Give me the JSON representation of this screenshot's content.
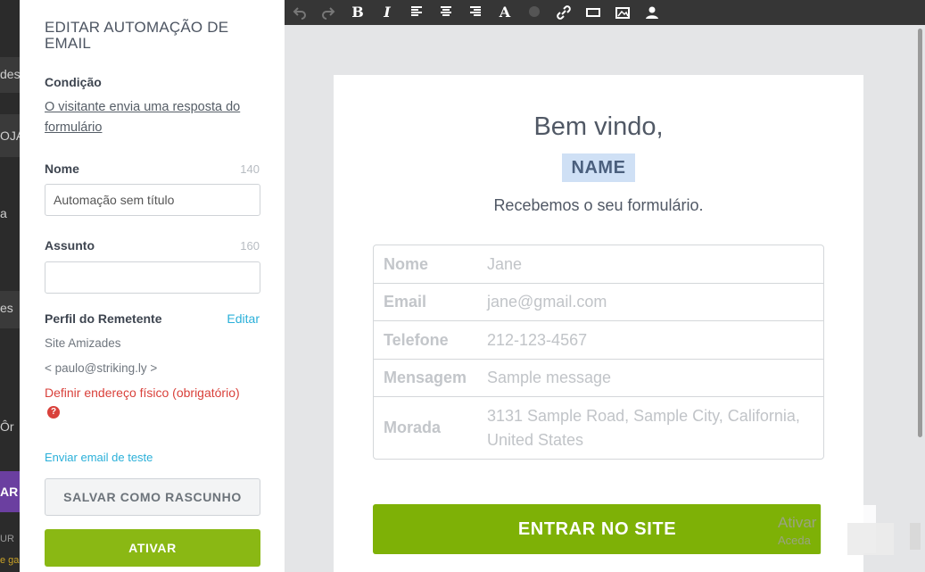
{
  "background": {
    "fragments": [
      "des",
      "OJA",
      "a",
      "es",
      "Ôr",
      "AR",
      "UR",
      "e ga"
    ]
  },
  "panel": {
    "title": "EDITAR AUTOMAÇÃO DE EMAIL",
    "condition_label": "Condição",
    "condition_link": "O visitante envia uma resposta do formulário",
    "name_label": "Nome",
    "name_counter": "140",
    "name_value": "Automação sem título",
    "subject_label": "Assunto",
    "subject_counter": "160",
    "subject_value": "",
    "sender_label": "Perfil do Remetente",
    "sender_edit": "Editar",
    "sender_name": "Site Amizades",
    "sender_email": "< paulo@striking.ly >",
    "address_warning": "Definir endereço físico (obrigatório)",
    "help_icon_glyph": "?",
    "test_email_link": "Enviar email de teste",
    "save_draft_label": "SALVAR COMO RASCUNHO",
    "activate_label": "ATIVAR"
  },
  "toolbar": {
    "icons": [
      "undo-icon",
      "redo-icon",
      "bold-icon",
      "italic-icon",
      "align-left-icon",
      "align-center-icon",
      "align-right-icon",
      "text-color-icon",
      "color-dot-icon",
      "link-icon",
      "button-icon",
      "image-icon",
      "person-icon"
    ],
    "bold_glyph": "B",
    "italic_glyph": "I",
    "text_color_glyph": "A"
  },
  "email": {
    "welcome": "Bem vindo,",
    "name_tag": "NAME",
    "received": "Recebemos o seu formulário.",
    "fields": [
      {
        "label": "Nome",
        "value": "Jane"
      },
      {
        "label": "Email",
        "value": "jane@gmail.com"
      },
      {
        "label": "Telefone",
        "value": "212-123-4567"
      },
      {
        "label": "Mensagem",
        "value": "Sample message"
      },
      {
        "label": "Morada",
        "value": "3131 Sample Road, Sample City, California, United States"
      }
    ],
    "cta_label": "ENTRAR NO SITE"
  },
  "watermark": {
    "line1": "Ativar",
    "line2": "Aceda"
  },
  "colors": {
    "accent_green": "#8ab814",
    "cta_green": "#7eb106",
    "link_blue": "#2bb0d9",
    "warning_red": "#d9413b",
    "toolbar_bg": "#363636"
  }
}
